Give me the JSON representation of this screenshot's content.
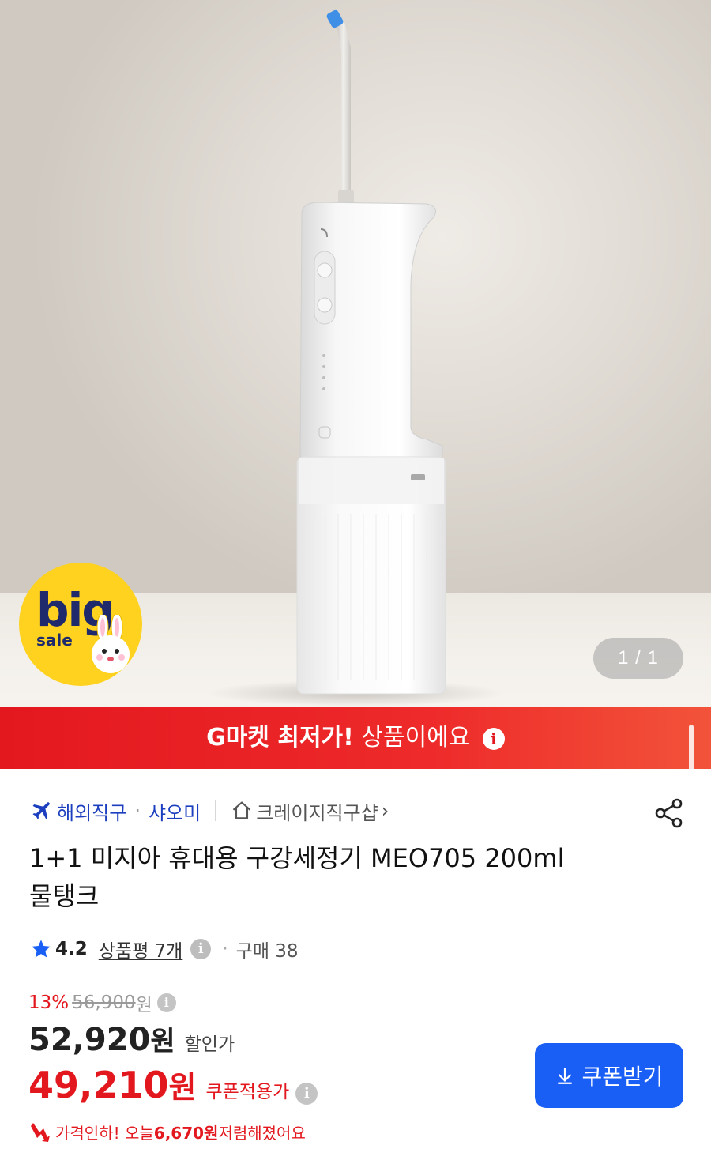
{
  "gallery": {
    "counter": "1 / 1",
    "badge_big": "big",
    "badge_sale": "sale"
  },
  "banner": {
    "bold_text": "G마켓 최저가!",
    "text": " 상품이에요"
  },
  "seller": {
    "tag": "해외직구",
    "brand": "샤오미",
    "shop": "크레이지직구샵",
    "shop_chevron": "›"
  },
  "product": {
    "title_line1": "1+1 미지아 휴대용 구강세정기 MEO705 200ml",
    "title_line2": "물탱크"
  },
  "rating": {
    "score": "4.2",
    "reviews": "상품평 7개",
    "purchases": "구매 38",
    "separator": "·"
  },
  "price": {
    "discount_rate": "13%",
    "original_price": "56,900",
    "original_unit": "원",
    "sale_price": "52,920",
    "sale_unit": "원",
    "sale_label": "할인가",
    "coupon_price": "49,210",
    "coupon_unit": "원",
    "coupon_label": "쿠폰적용가"
  },
  "coupon_button": {
    "label": "쿠폰받기"
  },
  "price_drop": {
    "prefix": "가격인하! 오늘 ",
    "amount": "6,670원",
    "suffix": " 저렴해졌어요"
  },
  "colors": {
    "accent_red": "#e3181f",
    "link_blue": "#1c3fbf",
    "button_blue": "#1a5ff5",
    "star_blue": "#1a5ff5"
  },
  "icons": [
    "airplane-icon",
    "home-icon",
    "share-icon",
    "star-icon",
    "info-icon",
    "download-icon",
    "down-arrow-icon"
  ]
}
